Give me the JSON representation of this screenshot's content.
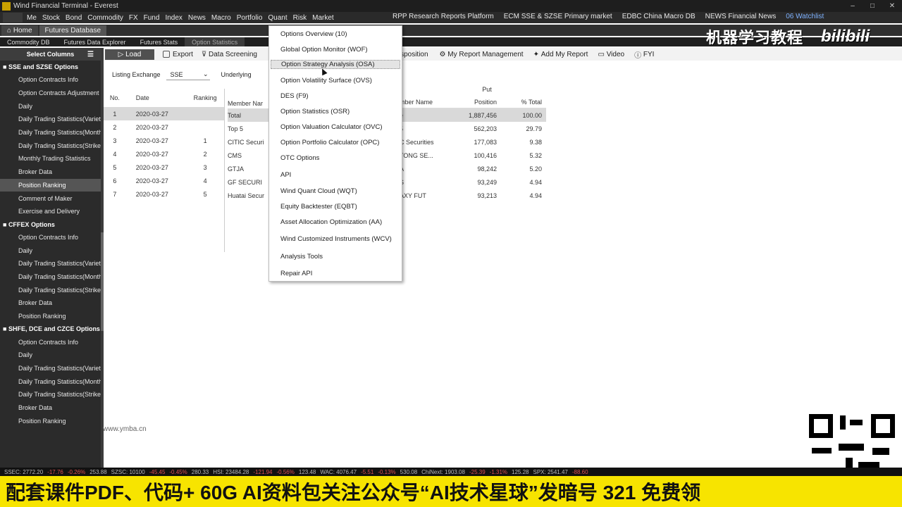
{
  "titlebar": {
    "title": "Wind Financial Terminal - Everest"
  },
  "menubar": {
    "items": [
      "Me",
      "Stock",
      "Bond",
      "Commodity",
      "FX",
      "Fund",
      "Index",
      "News",
      "Macro",
      "Portfolio",
      "Quant",
      "Risk",
      "Market"
    ],
    "right_items": [
      "RPP Research Reports Platform",
      "ECM SSE & SZSE Primary market",
      "EDBC China Macro DB",
      "NEWS Financial News",
      "06 Watchlist"
    ]
  },
  "page_tabs": [
    "Home",
    "Futures Database"
  ],
  "sub_tabs": [
    "Commodity DB",
    "Futures Data Explorer",
    "Futures Stats",
    "Option Statistics"
  ],
  "sidebar": {
    "header": "Select Columns",
    "groups": [
      {
        "label": "SSE and SZSE Options",
        "items": [
          "Option Contracts Info",
          "Option Contracts Adjustment",
          "Daily",
          "Daily Trading Statistics(Variety)",
          "Daily Trading Statistics(Month)",
          "Daily Trading Statistics(Strike)",
          "Monthly Trading Statistics",
          "Broker Data",
          "Position Ranking",
          "Comment of Maker",
          "Exercise and Delivery"
        ]
      },
      {
        "label": "CFFEX Options",
        "items": [
          "Option Contracts Info",
          "Daily",
          "Daily Trading Statistics(Variety)",
          "Daily Trading Statistics(Month)",
          "Daily Trading Statistics(Strike)",
          "Broker Data",
          "Position Ranking"
        ]
      },
      {
        "label": "SHFE, DCE and CZCE Options",
        "items": [
          "Option Contracts Info",
          "Daily",
          "Daily Trading Statistics(Variety)",
          "Daily Trading Statistics(Month)",
          "Daily Trading Statistics(Strike)",
          "Broker Data",
          "Position Ranking"
        ]
      }
    ]
  },
  "toolbar": {
    "load": "Load",
    "export": "Export",
    "data_screening": "Data Screening",
    "transposition": "ansposition",
    "my_report_mgmt": "My Report Management",
    "add_my_report": "Add My Report",
    "video": "Video",
    "fyi": "FYI"
  },
  "filters": {
    "exchange_label": "Listing Exchange",
    "exchange_value": "SSE",
    "underlying_label": "Underlying"
  },
  "left_table": {
    "headers": [
      "No.",
      "Date",
      "Ranking"
    ],
    "rows": [
      {
        "no": "1",
        "date": "2020-03-27",
        "rank": ""
      },
      {
        "no": "2",
        "date": "2020-03-27",
        "rank": ""
      },
      {
        "no": "3",
        "date": "2020-03-27",
        "rank": "1"
      },
      {
        "no": "4",
        "date": "2020-03-27",
        "rank": "2"
      },
      {
        "no": "5",
        "date": "2020-03-27",
        "rank": "3"
      },
      {
        "no": "6",
        "date": "2020-03-27",
        "rank": "4"
      },
      {
        "no": "7",
        "date": "2020-03-27",
        "rank": "5"
      }
    ]
  },
  "member_col": {
    "header": "Member Nar",
    "cells": [
      "Total",
      "Top 5",
      "CITIC Securi",
      "CMS",
      "GTJA",
      "GF SECURI",
      "Huatai Secur"
    ]
  },
  "put_table": {
    "group_header": "Put",
    "headers": [
      "mber Name",
      "Position",
      "% Total"
    ],
    "rows": [
      {
        "m": "e",
        "p": "1,887,456",
        "t": "100.00"
      },
      {
        "m": "5",
        "p": "562,203",
        "t": "29.79"
      },
      {
        "m": "C Securities",
        "p": "177,083",
        "t": "9.38"
      },
      {
        "m": "TONG SE...",
        "p": "100,416",
        "t": "5.32"
      },
      {
        "m": "A",
        "p": "98,242",
        "t": "5.20"
      },
      {
        "m": "S",
        "p": "93,249",
        "t": "4.94"
      },
      {
        "m": "AXY FUT",
        "p": "93,213",
        "t": "4.94"
      }
    ]
  },
  "dropdown": {
    "items": [
      "Options Overview (10)",
      "Global Option Monitor (WOF)",
      "Option Strategy Analysis (OSA)",
      "Option Volatility Surface (OVS)",
      "DES (F9)",
      "Option Statistics (OSR)",
      "Option Valuation Calculator (OVC)",
      "Option Portfolio Calculator (OPC)",
      "OTC Options",
      "API",
      "Wind Quant Cloud (WQT)",
      "Equity Backtester (EQBT)",
      "Asset Allocation Optimization (AA)",
      "Wind Customized Instruments (WCV)",
      "Analysis Tools",
      "Repair API"
    ],
    "hovered_index": 2
  },
  "watermark": {
    "text": "机器学习教程",
    "bili": "bilibili"
  },
  "site": "www.ymba.cn",
  "ticker": {
    "items": [
      "SSEC: 2772.20",
      "-17.76",
      "-0.26%",
      "253.88",
      "SZSC: 10100",
      "-45.45",
      "-0.45%",
      "280.33",
      "HSI: 23484.28",
      "-121.94",
      "-0.56%",
      "123.48",
      "WAC: 4076.47",
      "-5.51",
      "-0.13%",
      "530.08",
      "ChiNext: 1903.08",
      "-25.39",
      "-1.31%",
      "125.28",
      "SPX: 2541.47",
      "-88.60"
    ]
  },
  "banner": {
    "text": "配套课件PDF、代码+ 60G AI资料包关注公众号“AI技术星球”发暗号 321 免费领"
  }
}
